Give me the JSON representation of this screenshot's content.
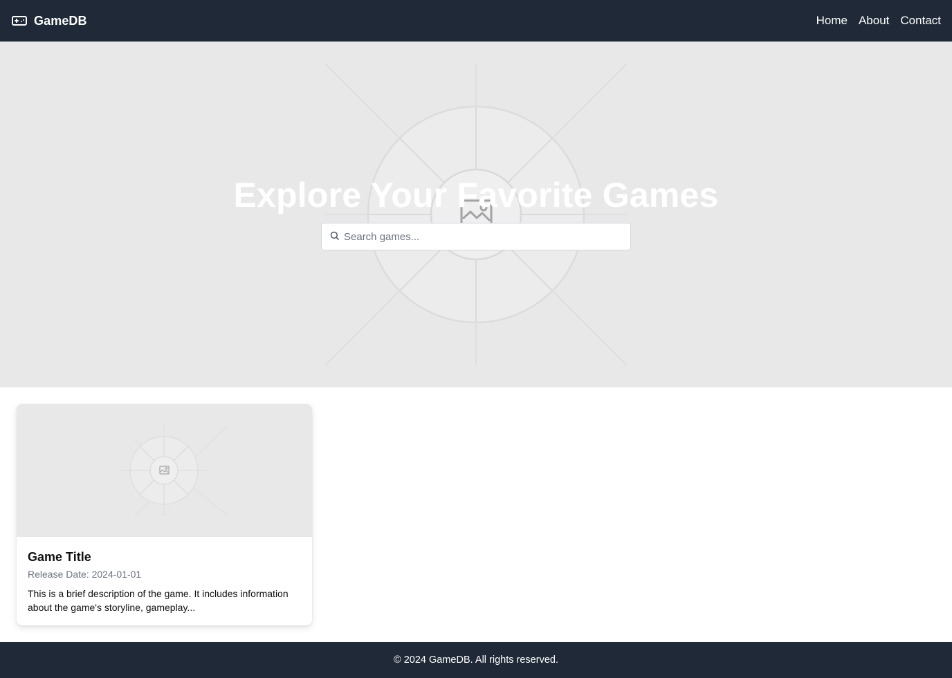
{
  "navbar": {
    "brand_icon": "gamepad-icon",
    "brand_name": "GameDB",
    "links": [
      {
        "label": "Home"
      },
      {
        "label": "About"
      },
      {
        "label": "Contact"
      }
    ]
  },
  "hero": {
    "image_icon": "image-placeholder-icon",
    "title": "Explore Your Favorite Games",
    "search": {
      "icon": "search-icon",
      "placeholder": "Search games...",
      "value": ""
    }
  },
  "games": [
    {
      "image_icon": "image-placeholder-icon",
      "title": "Game Title",
      "release_date": "Release Date: 2024-01-01",
      "description": "This is a brief description of the game. It includes information about the game's storyline, gameplay..."
    }
  ],
  "footer": {
    "text": "© 2024 GameDB. All rights reserved."
  },
  "colors": {
    "nav_bg": "#1f2937",
    "placeholder_bg": "#e8e8e8",
    "muted_text": "#6b7280"
  }
}
